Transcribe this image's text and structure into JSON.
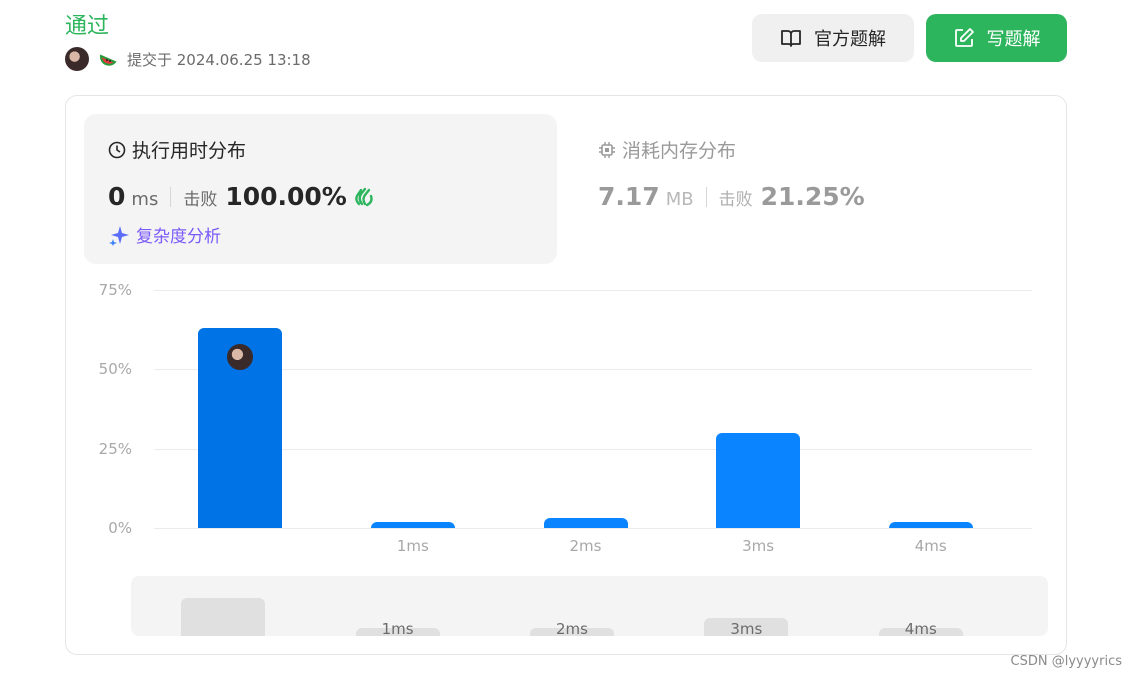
{
  "header": {
    "status": "通过",
    "submitted": "提交于 2024.06.25 13:18",
    "official_solution_label": "官方题解",
    "write_solution_label": "写题解"
  },
  "runtime": {
    "title": "执行用时分布",
    "value": "0",
    "unit": "ms",
    "beats_label": "击败",
    "beats_value": "100.00%",
    "complexity_label": "复杂度分析"
  },
  "memory": {
    "title": "消耗内存分布",
    "value": "7.17",
    "unit": "MB",
    "beats_label": "击败",
    "beats_value": "21.25%"
  },
  "chart_data": {
    "type": "bar",
    "categories": [
      "",
      "1ms",
      "2ms",
      "3ms",
      "4ms"
    ],
    "values": [
      63,
      2,
      3,
      30,
      2
    ],
    "ylim": [
      0,
      75
    ],
    "yticks": [
      "75%",
      "50%",
      "25%",
      "0%"
    ],
    "ytick_values": [
      75,
      50,
      25,
      0
    ],
    "grid": true,
    "colors": {
      "bar": "#0a84ff",
      "selected": "#0073e6"
    }
  },
  "brush": {
    "labels": [
      "1ms",
      "2ms",
      "3ms",
      "4ms"
    ]
  },
  "watermark": "CSDN @lyyyyrics",
  "colors": {
    "accent": "#2db55d",
    "complexity": "#7a5af8"
  }
}
